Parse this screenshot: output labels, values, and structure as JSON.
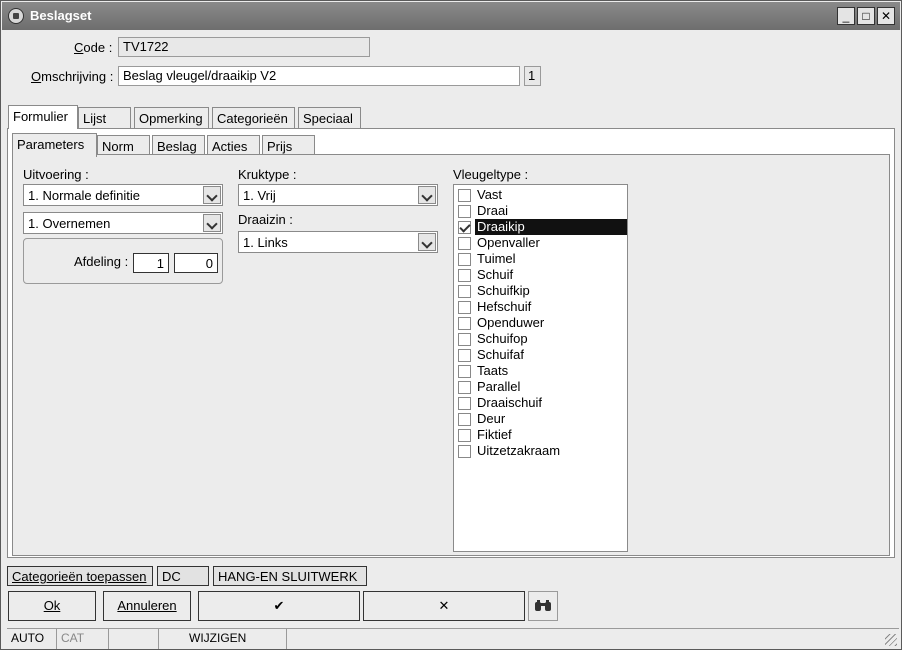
{
  "window": {
    "title": "Beslagset",
    "minimize": "_",
    "maximize": "□",
    "close": "✕"
  },
  "form": {
    "code_label": "Code :",
    "code_value": "TV1722",
    "omschrijving_label": "Omschrijving :",
    "omschrijving_value": "Beslag vleugel/draaikip V2",
    "omschrijving_count": "1"
  },
  "main_tabs": [
    "Formulier",
    "Lijst",
    "Opmerking",
    "Categorieën",
    "Speciaal"
  ],
  "sub_tabs": [
    "Parameters",
    "Norm",
    "Beslag",
    "Acties",
    "Prijs"
  ],
  "parameters": {
    "uitvoering_label": "Uitvoering :",
    "uitvoering_value": "1.  Normale definitie",
    "overnemen_value": "1.  Overnemen",
    "afdeling_label": "Afdeling :",
    "afdeling_value1": "1",
    "afdeling_value2": "0",
    "kruktype_label": "Kruktype :",
    "kruktype_value": "1.  Vrij",
    "draaizin_label": "Draaizin :",
    "draaizin_value": "1.  Links",
    "vleugeltype_label": "Vleugeltype :",
    "vleugeltypes": [
      {
        "label": "Vast",
        "checked": false
      },
      {
        "label": "Draai",
        "checked": false
      },
      {
        "label": "Draaikip",
        "checked": true,
        "selected": true
      },
      {
        "label": "Openvaller",
        "checked": false
      },
      {
        "label": "Tuimel",
        "checked": false
      },
      {
        "label": "Schuif",
        "checked": false
      },
      {
        "label": "Schuifkip",
        "checked": false
      },
      {
        "label": "Hefschuif",
        "checked": false
      },
      {
        "label": "Openduwer",
        "checked": false
      },
      {
        "label": "Schuifop",
        "checked": false
      },
      {
        "label": "Schuifaf",
        "checked": false
      },
      {
        "label": "Taats",
        "checked": false
      },
      {
        "label": "Parallel",
        "checked": false
      },
      {
        "label": "Draaischuif",
        "checked": false
      },
      {
        "label": "Deur",
        "checked": false
      },
      {
        "label": "Fiktief",
        "checked": false
      },
      {
        "label": "Uitzetzakraam",
        "checked": false
      }
    ]
  },
  "categories_bar": {
    "apply_label": "Categorieën toepassen",
    "cat1": "DC",
    "cat2": "HANG-EN SLUITWERK"
  },
  "buttons": {
    "ok": "Ok",
    "annuleren": "Annuleren",
    "confirm": "✔",
    "cancel": "✕"
  },
  "status": {
    "mode1": "AUTO",
    "mode2": "CAT",
    "mode3": "",
    "mode4": "WIJZIGEN"
  }
}
